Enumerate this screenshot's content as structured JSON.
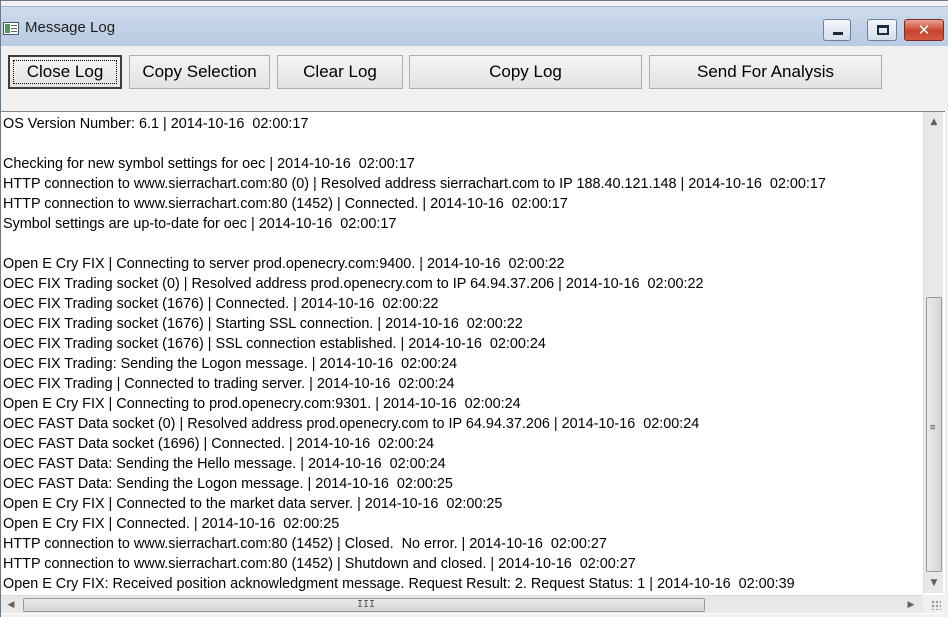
{
  "window": {
    "title": "Message Log",
    "icon": "window-icon",
    "controls": {
      "minimize": "minimize-icon",
      "maximize": "maximize-icon",
      "close_glyph": "✕"
    }
  },
  "toolbar": {
    "buttons": [
      {
        "label": "Close Log"
      },
      {
        "label": "Copy Selection"
      },
      {
        "label": "Clear Log"
      },
      {
        "label": "Copy Log"
      },
      {
        "label": "Send For Analysis"
      }
    ]
  },
  "log": {
    "lines": [
      "OS Version Number: 6.1 | 2014-10-16  02:00:17",
      "",
      "Checking for new symbol settings for oec | 2014-10-16  02:00:17",
      "HTTP connection to www.sierrachart.com:80 (0) | Resolved address sierrachart.com to IP 188.40.121.148 | 2014-10-16  02:00:17",
      "HTTP connection to www.sierrachart.com:80 (1452) | Connected. | 2014-10-16  02:00:17",
      "Symbol settings are up-to-date for oec | 2014-10-16  02:00:17",
      "",
      "Open E Cry FIX | Connecting to server prod.openecry.com:9400. | 2014-10-16  02:00:22",
      "OEC FIX Trading socket (0) | Resolved address prod.openecry.com to IP 64.94.37.206 | 2014-10-16  02:00:22",
      "OEC FIX Trading socket (1676) | Connected. | 2014-10-16  02:00:22",
      "OEC FIX Trading socket (1676) | Starting SSL connection. | 2014-10-16  02:00:22",
      "OEC FIX Trading socket (1676) | SSL connection established. | 2014-10-16  02:00:24",
      "OEC FIX Trading: Sending the Logon message. | 2014-10-16  02:00:24",
      "OEC FIX Trading | Connected to trading server. | 2014-10-16  02:00:24",
      "Open E Cry FIX | Connecting to prod.openecry.com:9301. | 2014-10-16  02:00:24",
      "OEC FAST Data socket (0) | Resolved address prod.openecry.com to IP 64.94.37.206 | 2014-10-16  02:00:24",
      "OEC FAST Data socket (1696) | Connected. | 2014-10-16  02:00:24",
      "OEC FAST Data: Sending the Hello message. | 2014-10-16  02:00:24",
      "OEC FAST Data: Sending the Logon message. | 2014-10-16  02:00:25",
      "Open E Cry FIX | Connected to the market data server. | 2014-10-16  02:00:25",
      "Open E Cry FIX | Connected. | 2014-10-16  02:00:25",
      "HTTP connection to www.sierrachart.com:80 (1452) | Closed.  No error. | 2014-10-16  02:00:27",
      "HTTP connection to www.sierrachart.com:80 (1452) | Shutdown and closed. | 2014-10-16  02:00:27",
      "Open E Cry FIX: Received position acknowledgment message. Request Result: 2. Request Status: 1 | 2014-10-16  02:00:39"
    ]
  },
  "scrollbars": {
    "up_arrow": "▲",
    "down_arrow": "▼",
    "left_arrow": "◀",
    "right_arrow": "▶",
    "grip_v": "≡",
    "grip_h": "III"
  }
}
